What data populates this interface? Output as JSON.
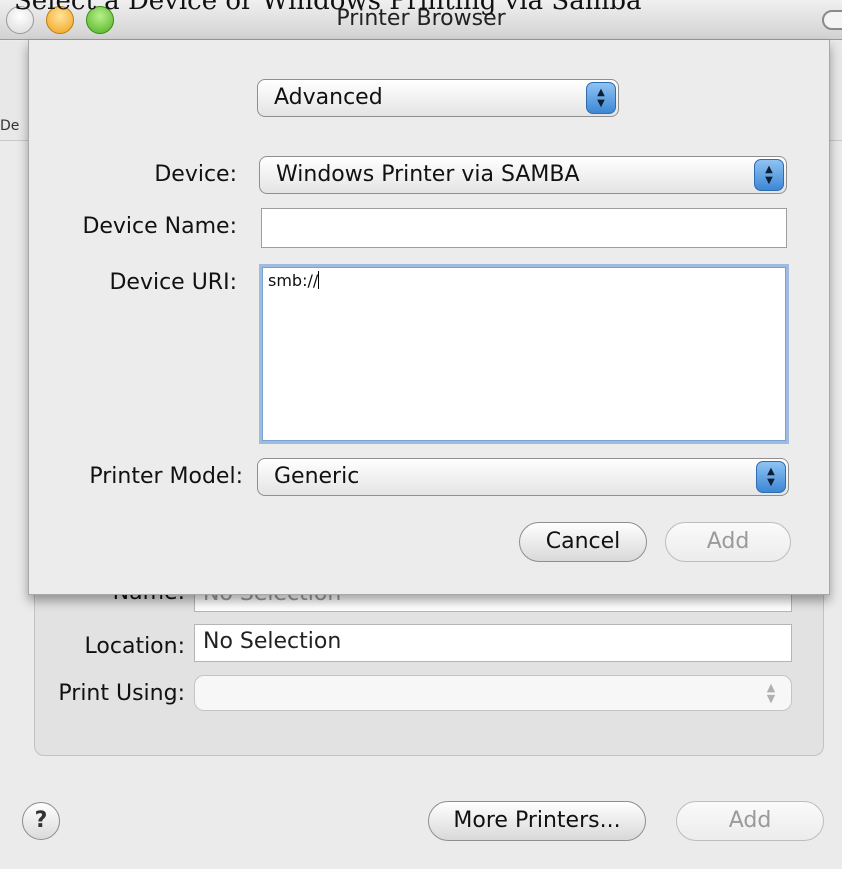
{
  "caption": "Select a Device or Windows Printing via Samba",
  "window": {
    "title": "Printer Browser",
    "left_edge_label": "De"
  },
  "background_panel": {
    "name_label": "Name:",
    "name_value": "No Selection",
    "location_label": "Location:",
    "location_value": "No Selection",
    "print_using_label": "Print Using:",
    "print_using_value": ""
  },
  "bottom_bar": {
    "help_label": "?",
    "more_printers_label": "More Printers...",
    "add_label": "Add"
  },
  "sheet": {
    "mode_popup": "Advanced",
    "device_label": "Device:",
    "device_value": "Windows Printer via SAMBA",
    "device_name_label": "Device Name:",
    "device_name_value": "",
    "device_uri_label": "Device URI:",
    "device_uri_value": "smb://",
    "printer_model_label": "Printer Model:",
    "printer_model_value": "Generic",
    "cancel_label": "Cancel",
    "add_label": "Add"
  },
  "colors": {
    "stepper_blue": "#3d87d6",
    "focus_ring": "#9dbce0"
  }
}
